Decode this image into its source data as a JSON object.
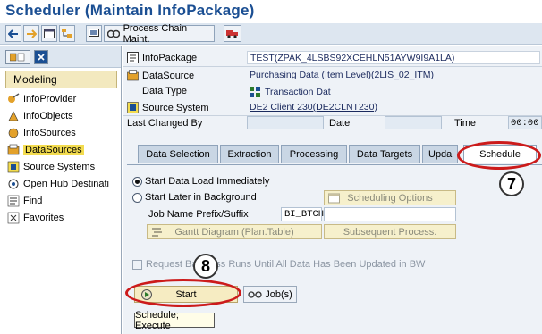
{
  "window": {
    "title": "Scheduler (Maintain InfoPackage)"
  },
  "toolbar": {
    "back_icon": "back-arrow-icon",
    "forward_icon": "forward-arrow-icon",
    "process_chain_label": "Process Chain Maint."
  },
  "left_panel": {
    "section_label": "Modeling",
    "items": [
      {
        "label": "InfoProvider",
        "icon": "infoprovider-icon"
      },
      {
        "label": "InfoObjects",
        "icon": "infoobjects-icon"
      },
      {
        "label": "InfoSources",
        "icon": "infosources-icon"
      },
      {
        "label": "DataSources",
        "icon": "datasources-icon"
      },
      {
        "label": "Source Systems",
        "icon": "source-systems-icon"
      },
      {
        "label": "Open Hub Destinati",
        "icon": "open-hub-icon"
      },
      {
        "label": "Find",
        "icon": "find-icon"
      },
      {
        "label": "Favorites",
        "icon": "favorites-icon"
      }
    ]
  },
  "header": {
    "infopackage_label": "InfoPackage",
    "infopackage_value": "TEST(ZPAK_4LSBS92XCEHLN51AYW9I9A1LA)",
    "datasource_label": "DataSource",
    "datasource_value": "Purchasing Data (Item Level)(2LIS_02_ITM)",
    "datatype_label": "Data Type",
    "datatype_value": "Transaction Dat",
    "source_system_label": "Source System",
    "source_system_value": "DE2 Client 230(DE2CLNT230)",
    "last_changed_label": "Last Changed By",
    "date_label": "Date",
    "time_label": "Time",
    "time_value": "00:00"
  },
  "tabs": [
    {
      "label": "Data Selection"
    },
    {
      "label": "Extraction"
    },
    {
      "label": "Processing"
    },
    {
      "label": "Data Targets"
    },
    {
      "label": "Upda"
    },
    {
      "label": "Schedule",
      "active": true
    }
  ],
  "schedule": {
    "start_immediately_label": "Start Data Load Immediately",
    "start_immediately_selected": true,
    "start_later_label": "Start Later in Background",
    "start_later_selected": false,
    "scheduling_options_label": "Scheduling Options",
    "job_name_label": "Job Name Prefix/Suffix",
    "job_name_value": "BI_BTCH",
    "gantt_label": "Gantt Diagram (Plan.Table)",
    "subsequent_label": "Subsequent Process.",
    "request_checkbox_label": "Request Ba      ocess Runs Until All Data Has Been Updated in BW",
    "start_label": "Start",
    "jobs_label": "Job(s)",
    "tooltip": "Schedule; Execute"
  },
  "annotations": {
    "step7": "7",
    "step8": "8"
  },
  "colors": {
    "title": "#1b4f93",
    "highlight_ring": "#cc1b1b",
    "active_nav": "#f3dc4f"
  }
}
